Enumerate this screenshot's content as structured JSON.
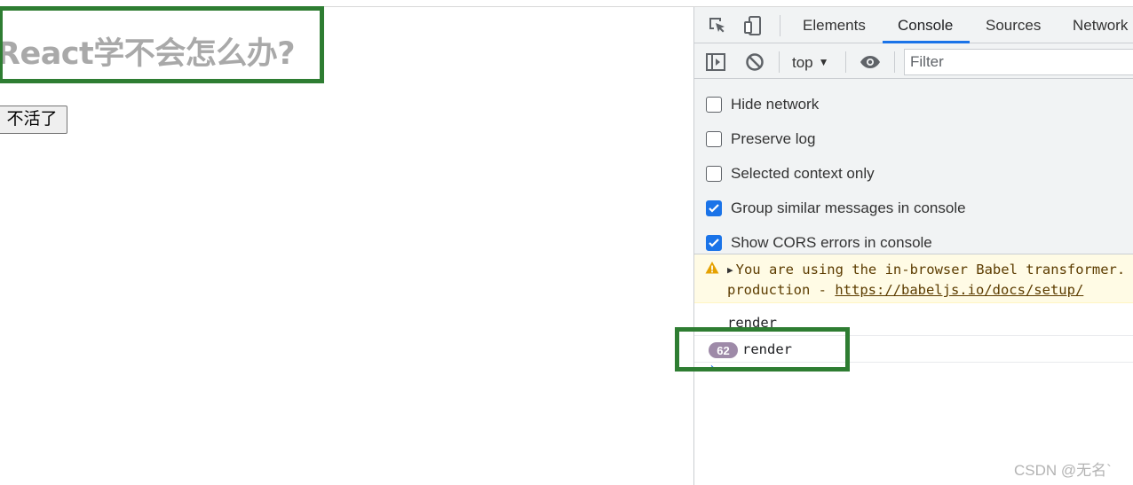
{
  "page": {
    "heading": "React学不会怎么办?",
    "button_label": "不活了"
  },
  "devtools": {
    "tabs": [
      {
        "label": "Elements",
        "active": false
      },
      {
        "label": "Console",
        "active": true
      },
      {
        "label": "Sources",
        "active": false
      },
      {
        "label": "Network",
        "active": false
      }
    ],
    "toolbar": {
      "context": "top",
      "filter_placeholder": "Filter"
    },
    "settings": [
      {
        "label": "Hide network",
        "checked": false
      },
      {
        "label": "Preserve log",
        "checked": false
      },
      {
        "label": "Selected context only",
        "checked": false
      },
      {
        "label": "Group similar messages in console",
        "checked": true
      },
      {
        "label": "Show CORS errors in console",
        "checked": true
      }
    ],
    "console": {
      "warning": {
        "line1": "You are using the in-browser Babel transformer.",
        "line2_prefix": "production - ",
        "link": "https://babeljs.io/docs/setup/"
      },
      "log1": "render",
      "log2_count": "62",
      "log2": "render",
      "prompt": "›"
    }
  },
  "watermark": "CSDN @无名`",
  "colors": {
    "highlight_box": "#2e7d32",
    "accent": "#1a73e8",
    "warning_bg": "#fffbe5",
    "badge": "#9e8aa8"
  }
}
